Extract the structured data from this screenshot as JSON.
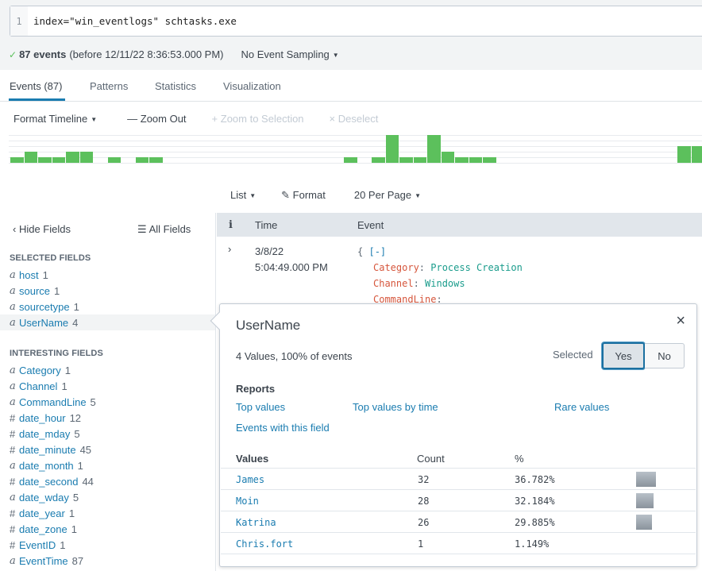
{
  "search": {
    "line_number": "1",
    "query": "index=\"win_eventlogs\" schtasks.exe"
  },
  "status": {
    "check_icon": "check-icon",
    "event_count": "87 events",
    "range_text": "(before 12/11/22 8:36:53.000 PM)",
    "sampling_label": "No Event Sampling"
  },
  "tabs": [
    {
      "label": "Events (87)",
      "active": true
    },
    {
      "label": "Patterns",
      "active": false
    },
    {
      "label": "Statistics",
      "active": false
    },
    {
      "label": "Visualization",
      "active": false
    }
  ],
  "timeline_toolbar": {
    "format_timeline": "Format Timeline",
    "zoom_out": "Zoom Out",
    "zoom_to_selection": "Zoom to Selection",
    "deselect": "Deselect"
  },
  "timeline": {
    "color": "#5cc05c",
    "max_units": 5,
    "buckets": [
      1,
      2,
      1,
      1,
      2,
      2,
      0,
      1,
      0,
      1,
      1,
      0,
      0,
      0,
      0,
      0,
      0,
      0,
      0,
      0,
      0,
      0,
      0,
      0,
      1,
      0,
      1,
      5,
      1,
      1,
      5,
      2,
      1,
      1,
      1,
      0,
      0,
      0,
      0,
      0,
      0,
      0,
      0,
      0,
      0,
      0,
      0,
      0,
      3,
      3
    ]
  },
  "results_toolbar": {
    "list": "List",
    "format": "Format",
    "per_page": "20 Per Page"
  },
  "sidebar": {
    "hide_fields": "Hide Fields",
    "all_fields": "All Fields",
    "selected_title": "SELECTED FIELDS",
    "selected_fields": [
      {
        "type": "a",
        "name": "host",
        "count": "1"
      },
      {
        "type": "a",
        "name": "source",
        "count": "1"
      },
      {
        "type": "a",
        "name": "sourcetype",
        "count": "1"
      },
      {
        "type": "a",
        "name": "UserName",
        "count": "4",
        "highlight": true
      }
    ],
    "interesting_title": "INTERESTING FIELDS",
    "interesting_fields": [
      {
        "type": "a",
        "name": "Category",
        "count": "1"
      },
      {
        "type": "a",
        "name": "Channel",
        "count": "1"
      },
      {
        "type": "a",
        "name": "CommandLine",
        "count": "5"
      },
      {
        "type": "#",
        "name": "date_hour",
        "count": "12"
      },
      {
        "type": "#",
        "name": "date_mday",
        "count": "5"
      },
      {
        "type": "#",
        "name": "date_minute",
        "count": "45"
      },
      {
        "type": "a",
        "name": "date_month",
        "count": "1"
      },
      {
        "type": "#",
        "name": "date_second",
        "count": "44"
      },
      {
        "type": "a",
        "name": "date_wday",
        "count": "5"
      },
      {
        "type": "#",
        "name": "date_year",
        "count": "1"
      },
      {
        "type": "#",
        "name": "date_zone",
        "count": "1"
      },
      {
        "type": "#",
        "name": "EventID",
        "count": "1"
      },
      {
        "type": "a",
        "name": "EventTime",
        "count": "87"
      }
    ]
  },
  "events_table": {
    "headers": {
      "info": "i",
      "time": "Time",
      "event": "Event"
    },
    "row": {
      "date": "3/8/22",
      "time": "5:04:49.000 PM",
      "open_brace": "{",
      "collapse_toggle": "[-]",
      "fields": [
        {
          "key": "Category",
          "value": "Process Creation"
        },
        {
          "key": "Channel",
          "value": "Windows"
        },
        {
          "key": "CommandLine",
          "value": ""
        }
      ]
    }
  },
  "popover": {
    "title": "UserName",
    "summary": "4 Values, 100% of events",
    "selected_label": "Selected",
    "yes_label": "Yes",
    "no_label": "No",
    "selected_value": "Yes",
    "reports_title": "Reports",
    "reports": [
      "Top values",
      "Top values by time",
      "Rare values",
      "Events with this field"
    ],
    "values_header": {
      "value": "Values",
      "count": "Count",
      "pct": "%"
    },
    "values": [
      {
        "value": "James",
        "count": "32",
        "pct": "36.782%",
        "fraction": 0.36782
      },
      {
        "value": "Moin",
        "count": "28",
        "pct": "32.184%",
        "fraction": 0.32184
      },
      {
        "value": "Katrina",
        "count": "26",
        "pct": "29.885%",
        "fraction": 0.29885
      },
      {
        "value": "Chris.fort",
        "count": "1",
        "pct": "1.149%",
        "fraction": 0.01149
      }
    ]
  }
}
